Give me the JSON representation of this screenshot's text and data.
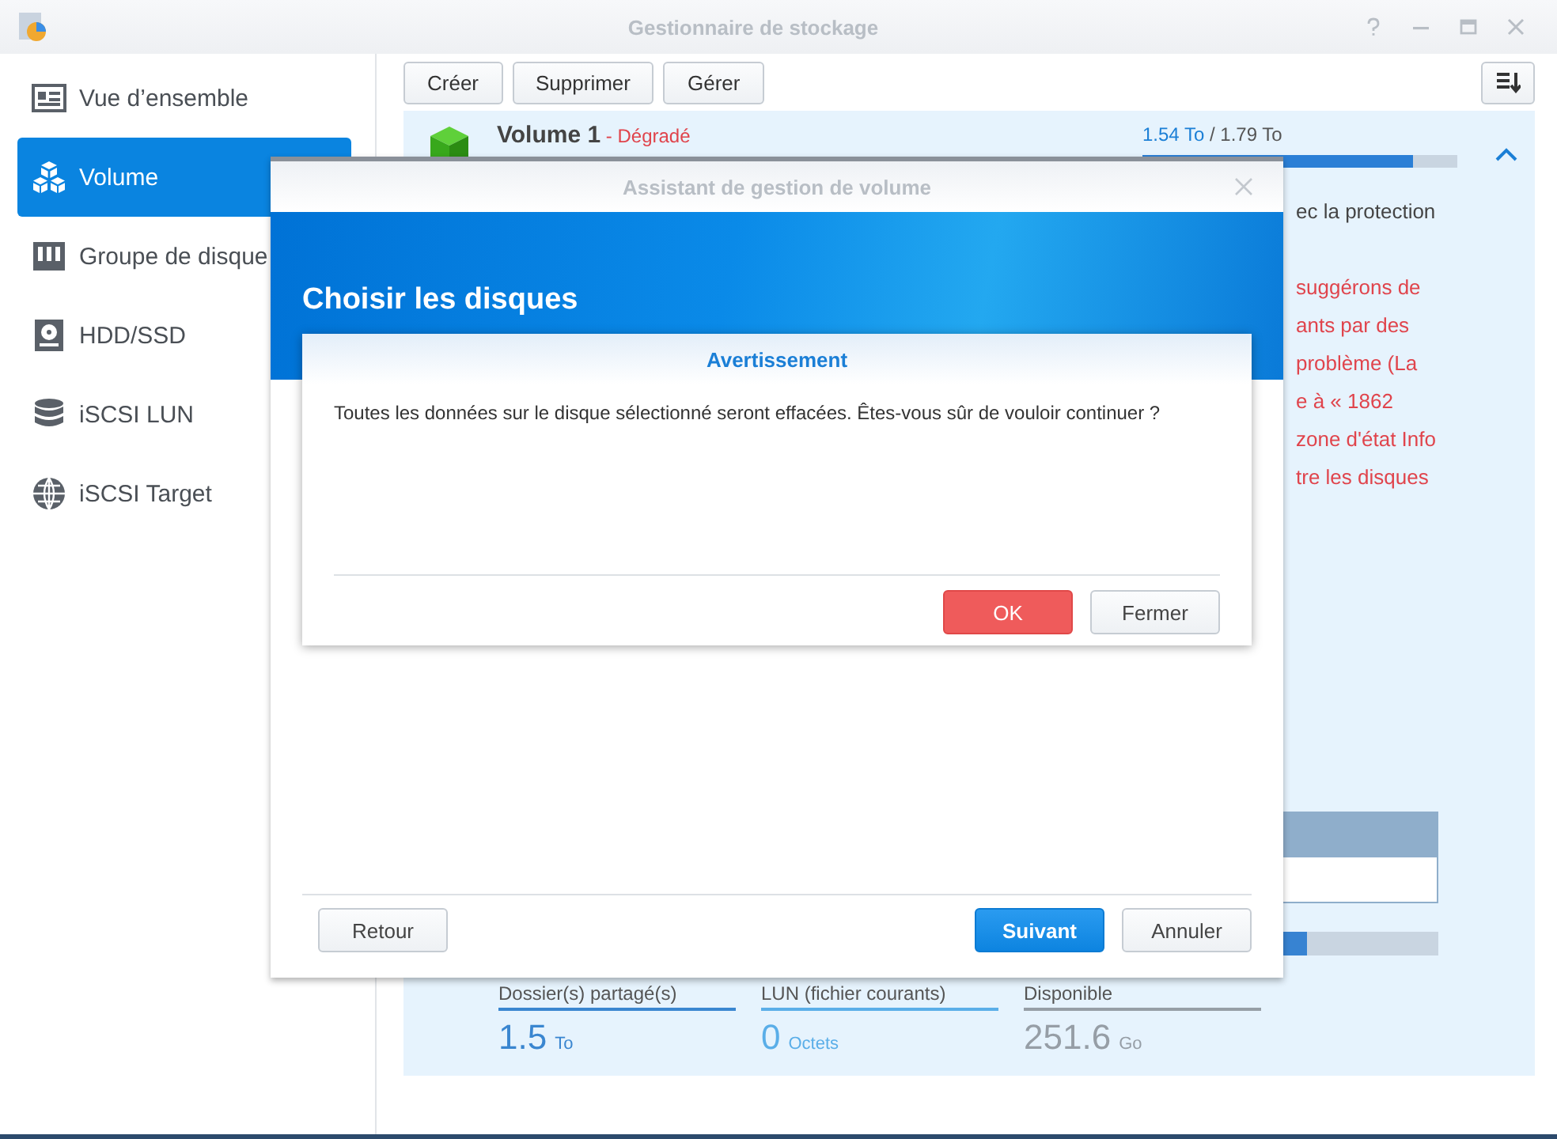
{
  "window": {
    "title": "Gestionnaire de stockage"
  },
  "sidebar": {
    "items": [
      {
        "label": "Vue d’ensemble",
        "selected": false
      },
      {
        "label": "Volume",
        "selected": true
      },
      {
        "label": "Groupe de disque",
        "selected": false
      },
      {
        "label": "HDD/SSD",
        "selected": false
      },
      {
        "label": "iSCSI LUN",
        "selected": false
      },
      {
        "label": "iSCSI Target",
        "selected": false
      }
    ]
  },
  "toolbar": {
    "buttons": [
      "Créer",
      "Supprimer",
      "Gérer"
    ]
  },
  "volume": {
    "name": "Volume 1",
    "status": " - Dégradé",
    "used": "1.54 To",
    "total": " / 1.79 To",
    "level": 0.86,
    "description": [
      {
        "text": "ec la protection",
        "kind": "note"
      },
      {
        "text": "suggérons de",
        "kind": "warning"
      },
      {
        "text": "ants par des",
        "kind": "warning"
      },
      {
        "text": "problème (La",
        "kind": "warning"
      },
      {
        "text": "e à « 1862",
        "kind": "warning"
      },
      {
        "text": "zone d'état Info",
        "kind": "warning"
      },
      {
        "text": "tre les disques",
        "kind": "warning"
      }
    ],
    "usage_bar": {
      "level": 0.86
    },
    "stats": [
      {
        "label": "Dossier(s) partagé(s)",
        "value": "1.5",
        "unit": "To",
        "color": "#3a86d0"
      },
      {
        "label": "LUN (fichier courants)",
        "value": "0",
        "unit": "Octets",
        "color": "#5aaee8"
      },
      {
        "label": "Disponible",
        "value": "251.6",
        "unit": "Go",
        "color": "#969ea6"
      }
    ]
  },
  "wizard": {
    "title": "Assistant de gestion de volume",
    "heading": "Choisir les disques",
    "buttons": [
      {
        "label": "Retour",
        "kind": "default"
      },
      {
        "label": "Suivant",
        "kind": "primary"
      },
      {
        "label": "Annuler",
        "kind": "default"
      }
    ]
  },
  "warning": {
    "title": "Avertissement",
    "message": "Toutes les données sur le disque sélectionné seront effacées. Êtes-vous sûr de vouloir continuer ?",
    "buttons": [
      {
        "label": "OK",
        "kind": "danger"
      },
      {
        "label": "Fermer",
        "kind": "default"
      }
    ]
  }
}
